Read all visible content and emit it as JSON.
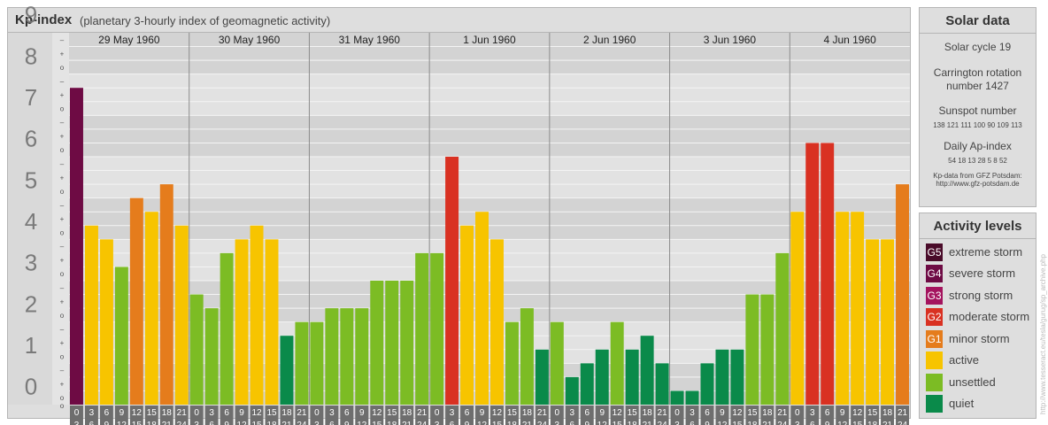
{
  "header": {
    "title": "Kp-index",
    "subtitle": "(planetary 3-hourly index of geomagnetic activity)"
  },
  "chart_data": {
    "type": "bar",
    "title": "Kp-index",
    "subtitle": "(planetary 3-hourly index of geomagnetic activity)",
    "ylim": [
      0,
      9
    ],
    "y_ticks": [
      "0",
      "1",
      "2",
      "3",
      "4",
      "5",
      "6",
      "7",
      "8",
      "9"
    ],
    "minor_ticks": [
      "+",
      "o",
      "–"
    ],
    "days": [
      "29 May 1960",
      "30 May 1960",
      "31 May 1960",
      "1 Jun 1960",
      "2 Jun 1960",
      "3 Jun 1960",
      "4 Jun 1960"
    ],
    "interval_starts": [
      "0",
      "3",
      "6",
      "9",
      "12",
      "15",
      "18",
      "21"
    ],
    "interval_ends": [
      "3",
      "6",
      "9",
      "12",
      "15",
      "18",
      "21",
      "24"
    ],
    "values": [
      [
        7.667,
        4.333,
        4.0,
        3.333,
        5.0,
        4.667,
        5.333,
        4.333
      ],
      [
        2.667,
        2.333,
        3.667,
        4.0,
        4.333,
        4.0,
        1.667,
        2.0
      ],
      [
        2.0,
        2.333,
        2.333,
        2.333,
        3.0,
        3.0,
        3.0,
        3.667
      ],
      [
        3.667,
        6.0,
        4.333,
        4.667,
        4.0,
        2.0,
        2.333,
        1.333
      ],
      [
        2.0,
        0.667,
        1.0,
        1.333,
        2.0,
        1.333,
        1.667,
        1.0
      ],
      [
        0.333,
        0.333,
        1.0,
        1.333,
        1.333,
        2.667,
        2.667,
        3.667
      ],
      [
        4.667,
        6.333,
        6.333,
        4.667,
        4.667,
        4.0,
        4.0,
        5.333
      ]
    ]
  },
  "solar": {
    "title": "Solar data",
    "cycle": "Solar cycle 19",
    "carrington": "Carrington rotation number 1427",
    "sunspot_label": "Sunspot number",
    "sunspot_values": "138 121 111 100 90 109 113",
    "ap_label": "Daily Ap-index",
    "ap_values": "54 18 13 28 5 8 52",
    "source_line1": "Kp-data from GFZ Potsdam:",
    "source_line2": "http://www.gfz-potsdam.de"
  },
  "levels": {
    "title": "Activity levels",
    "items": [
      {
        "code": "G5",
        "label": "extreme storm",
        "color": "#4a0c2a"
      },
      {
        "code": "G4",
        "label": "severe storm",
        "color": "#6e0b44"
      },
      {
        "code": "G3",
        "label": "strong storm",
        "color": "#a4145e"
      },
      {
        "code": "G2",
        "label": "moderate storm",
        "color": "#d93122"
      },
      {
        "code": "G1",
        "label": "minor storm",
        "color": "#e57c1c"
      },
      {
        "code": "",
        "label": "active",
        "color": "#f7c400"
      },
      {
        "code": "",
        "label": "unsettled",
        "color": "#7cbc24"
      },
      {
        "code": "",
        "label": "quiet",
        "color": "#0a8a4a"
      }
    ]
  },
  "watermark": "http://www.tesseract.eu/tesla/gurug/sp_archive.php"
}
